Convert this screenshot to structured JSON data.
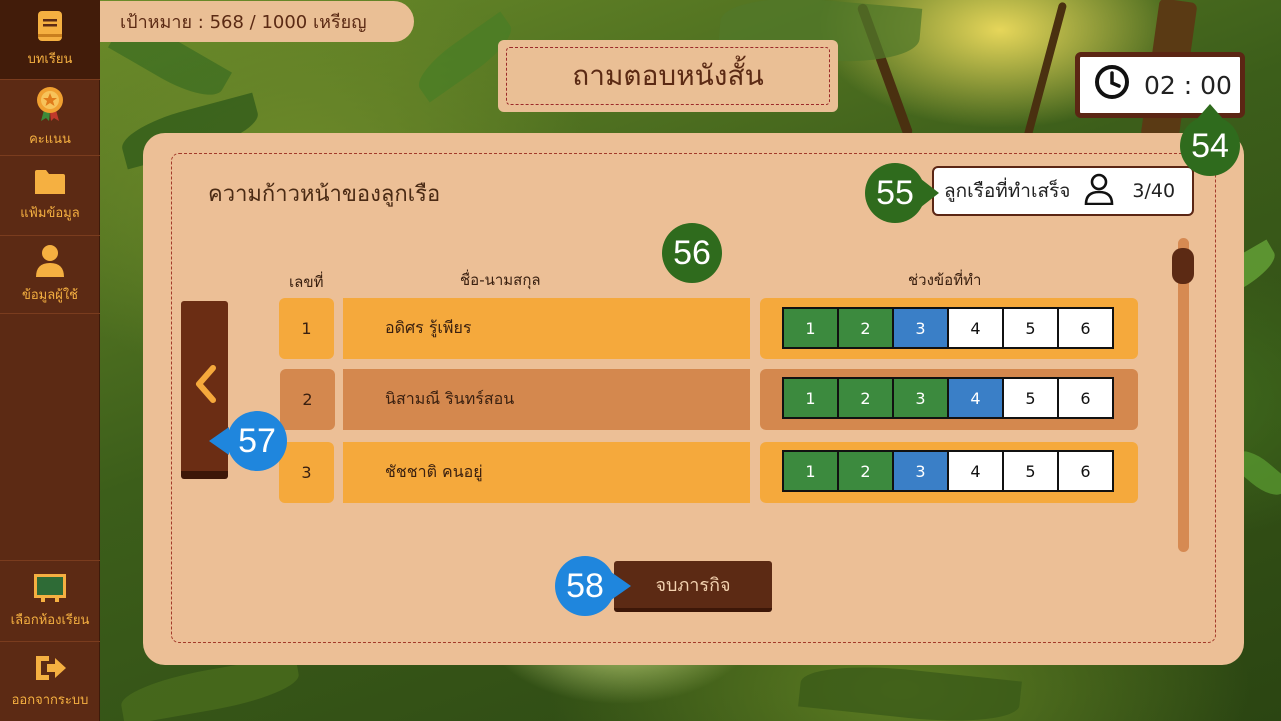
{
  "sidebar": {
    "items": [
      {
        "label": "บทเรียน",
        "icon": "book-icon",
        "active": true
      },
      {
        "label": "คะแนน",
        "icon": "medal-icon",
        "active": false
      },
      {
        "label": "แฟ้มข้อมูล",
        "icon": "folder-icon",
        "active": false
      },
      {
        "label": "ข้อมูลผู้ใช้",
        "icon": "user-icon",
        "active": false
      }
    ],
    "bottom_items": [
      {
        "label": "เลือกห้องเรียน",
        "icon": "blackboard-icon"
      },
      {
        "label": "ออกจากระบบ",
        "icon": "logout-icon"
      }
    ]
  },
  "goal": {
    "text": "เป้าหมาย : 568 / 1000 เหรียญ"
  },
  "title": "ถามตอบหนังสั้น",
  "timer": {
    "value": "02 : 00",
    "icon": "clock-icon"
  },
  "panel": {
    "heading": "ความก้าวหน้าของลูกเรือ",
    "done": {
      "label": "ลูกเรือที่ทำเสร็จ",
      "count": "3/40",
      "icon": "user-outline-icon"
    },
    "columns": {
      "number": "เลขที่",
      "name": "ชื่อ-นามสกุล",
      "range": "ช่วงข้อที่ทำ"
    },
    "rows": [
      {
        "number": "1",
        "name": "อดิศร รู้เพียร",
        "segments": [
          "1",
          "2",
          "3",
          "4",
          "5",
          "6"
        ],
        "completed": 2,
        "current": 3
      },
      {
        "number": "2",
        "name": "นิสามณี รินทร์สอน",
        "segments": [
          "1",
          "2",
          "3",
          "4",
          "5",
          "6"
        ],
        "completed": 3,
        "current": 4
      },
      {
        "number": "3",
        "name": "ชัชชาติ คนอยู่",
        "segments": [
          "1",
          "2",
          "3",
          "4",
          "5",
          "6"
        ],
        "completed": 2,
        "current": 3
      }
    ],
    "prev_icon": "chevron-left-icon",
    "end_button": "จบภารกิจ"
  },
  "badges": [
    "54",
    "55",
    "56",
    "57",
    "58"
  ],
  "colors": {
    "sidebar": "#5c2a14",
    "accent_orange": "#f5a93c",
    "row_alt": "#d4884e",
    "segment_done": "#3c8a3e",
    "segment_current": "#3a7fc7",
    "badge_green": "#2f6b1d",
    "badge_blue": "#1f86dd"
  }
}
